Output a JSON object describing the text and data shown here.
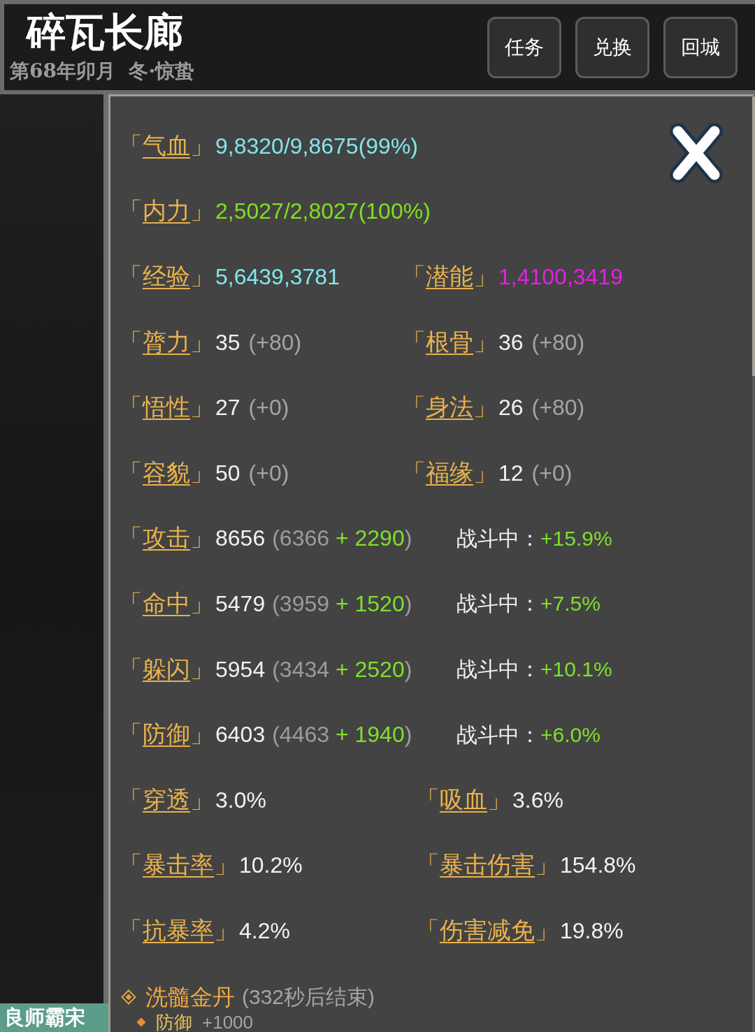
{
  "header": {
    "title": "碎瓦长廊",
    "date": "第68年卯月  冬·惊蛰"
  },
  "buttons": [
    {
      "label": "任务"
    },
    {
      "label": "兑换"
    },
    {
      "label": "回城"
    }
  ],
  "badge": "良师霸宋",
  "stats": [
    {
      "kind": "resource",
      "cells": [
        {
          "label": "「气血」",
          "value": "9,8320/9,8675(99%)",
          "color": "#80e8ec"
        }
      ]
    },
    {
      "kind": "resource",
      "cells": [
        {
          "label": "「内力」",
          "value": "2,5027/2,8027(100%)",
          "color": "#80e020"
        }
      ]
    },
    {
      "kind": "resource",
      "cells": [
        {
          "label": "「经验」",
          "value": "5,6439,3781",
          "color": "#80e8ec"
        },
        {
          "label": "「潜能」",
          "value": "1,4100,3419",
          "color": "#e81ee8"
        }
      ]
    },
    {
      "kind": "attribute",
      "cells": [
        {
          "label": "「膂力」",
          "value": "35",
          "bonus": "(+80)"
        },
        {
          "label": "「根骨」",
          "value": "36",
          "bonus": "(+80)"
        }
      ]
    },
    {
      "kind": "attribute",
      "cells": [
        {
          "label": "「悟性」",
          "value": "27",
          "bonus": "(+0)"
        },
        {
          "label": "「身法」",
          "value": "26",
          "bonus": "(+80)"
        }
      ]
    },
    {
      "kind": "attribute",
      "cells": [
        {
          "label": "「容貌」",
          "value": "50",
          "bonus": "(+0)"
        },
        {
          "label": "「福缘」",
          "value": "12",
          "bonus": "(+0)"
        }
      ]
    },
    {
      "kind": "combat",
      "label": "「攻击」",
      "total": "8656",
      "base": "(6366",
      "bonus": "+ 2290",
      "end": ")",
      "battle_label": "战斗中：",
      "battle_bonus": "+15.9%"
    },
    {
      "kind": "combat",
      "label": "「命中」",
      "total": "5479",
      "base": "(3959",
      "bonus": "+ 1520",
      "end": ")",
      "battle_label": "战斗中：",
      "battle_bonus": "+7.5%"
    },
    {
      "kind": "combat",
      "label": "「躲闪」",
      "total": "5954",
      "base": "(3434",
      "bonus": "+ 2520",
      "end": ")",
      "battle_label": "战斗中：",
      "battle_bonus": "+10.1%"
    },
    {
      "kind": "combat",
      "label": "「防御」",
      "total": "6403",
      "base": "(4463",
      "bonus": "+ 1940",
      "end": ")",
      "battle_label": "战斗中：",
      "battle_bonus": "+6.0%"
    },
    {
      "kind": "percent",
      "cells": [
        {
          "label": "「穿透」",
          "value": "3.0%"
        },
        {
          "label": "「吸血」",
          "value": "3.6%"
        }
      ]
    },
    {
      "kind": "percent",
      "cells": [
        {
          "label": "「暴击率」",
          "value": "10.2%"
        },
        {
          "label": "「暴击伤害」",
          "value": "154.8%"
        }
      ]
    },
    {
      "kind": "percent",
      "cells": [
        {
          "label": "「抗暴率」",
          "value": "4.2%"
        },
        {
          "label": "「伤害减免」",
          "value": "19.8%"
        }
      ]
    }
  ],
  "buffs": [
    {
      "name": "洗髓金丹",
      "remaining": "(332秒后结束)",
      "effects": [
        {
          "name": "防御",
          "value": "+1000"
        }
      ]
    }
  ]
}
